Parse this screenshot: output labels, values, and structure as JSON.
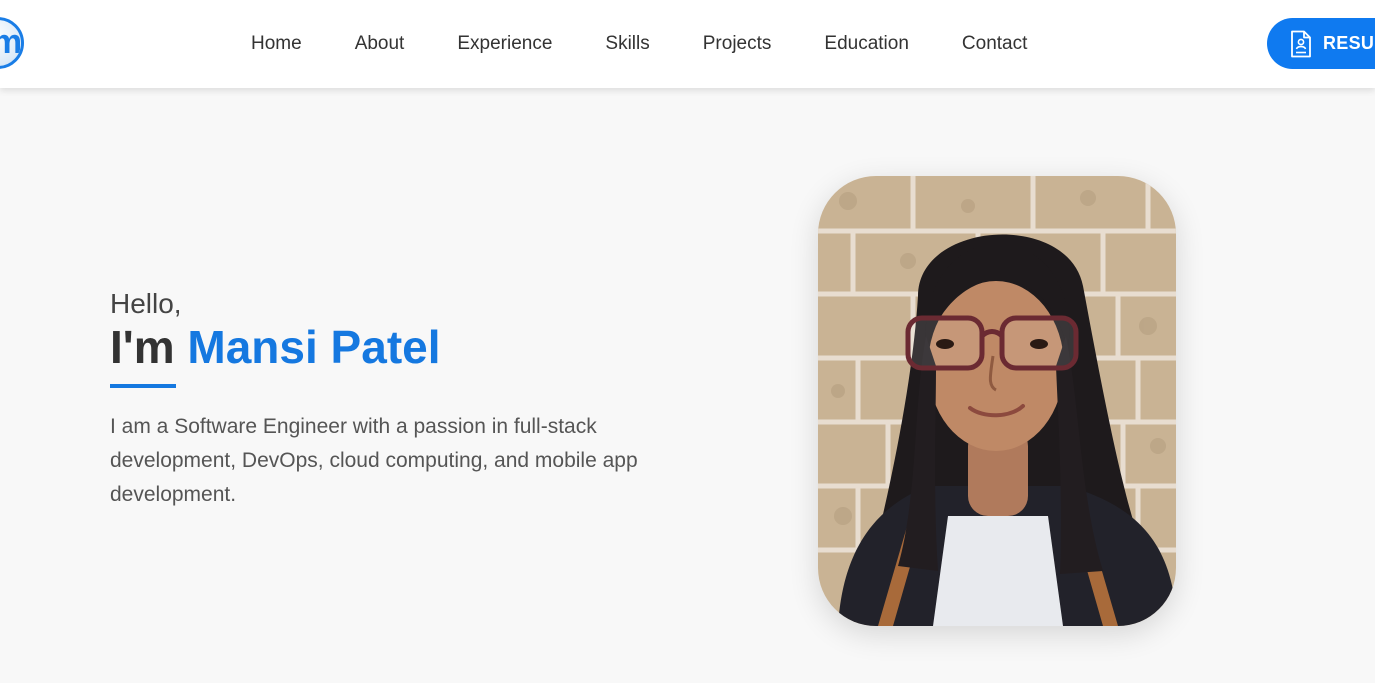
{
  "nav": {
    "logo_letter": "m",
    "links": [
      "Home",
      "About",
      "Experience",
      "Skills",
      "Projects",
      "Education",
      "Contact"
    ],
    "resume_label": "RESUME",
    "resume_icon": "document-icon"
  },
  "hero": {
    "greeting": "Hello,",
    "im_prefix": "I'm",
    "name": "Mansi Patel",
    "intro": "I am a Software Engineer with a passion in full-stack development, DevOps, cloud computing, and mobile app development.",
    "photo_label": "profile-photo"
  },
  "colors": {
    "accent": "#1578e0",
    "button": "#0f7af0",
    "background": "#f8f8f8",
    "nav_background": "#ffffff"
  }
}
